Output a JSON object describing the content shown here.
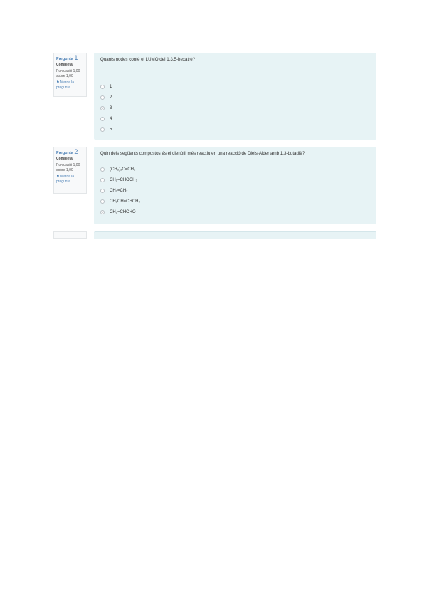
{
  "questions": [
    {
      "label": "Pregunta ",
      "number": "1",
      "state": "Completa",
      "grade_line1": "Puntuació 1,00",
      "grade_line2": "sobre 1,00",
      "flag_line1": "Marca la",
      "flag_line2": "pregunta",
      "text": "Quants nodes conté el LUMO del 1,3,5-hexatrè?",
      "answers": [
        {
          "label": "1",
          "selected": false
        },
        {
          "label": "2",
          "selected": false
        },
        {
          "label": "3",
          "selected": true
        },
        {
          "label": "4",
          "selected": false
        },
        {
          "label": "5",
          "selected": false
        }
      ]
    },
    {
      "label": "Pregunta ",
      "number": "2",
      "state": "Completa",
      "grade_line1": "Puntuació 1,00",
      "grade_line2": "sobre 1,00",
      "flag_line1": "Marca la",
      "flag_line2": "pregunta",
      "text": "Quin dels següents compostos és el dienòfil més reactiu en una reacció de Diels-Alder amb 1,3-butadiè?",
      "answers": [
        {
          "label": "(CH₃)₂C=CH₂",
          "selected": false
        },
        {
          "label": "CH₂=CHOCH₃",
          "selected": false
        },
        {
          "label": "CH₂=CH₂",
          "selected": false
        },
        {
          "label": "CH₂CH=CHCH₃",
          "selected": false
        },
        {
          "label": "CH₂=CHCHO",
          "selected": true
        }
      ]
    }
  ],
  "icons": {
    "flag": "flag-icon"
  },
  "colors": {
    "panel_bg": "#e7f3f5",
    "info_bg": "#f8f9fa",
    "link": "#4a7fb5"
  }
}
